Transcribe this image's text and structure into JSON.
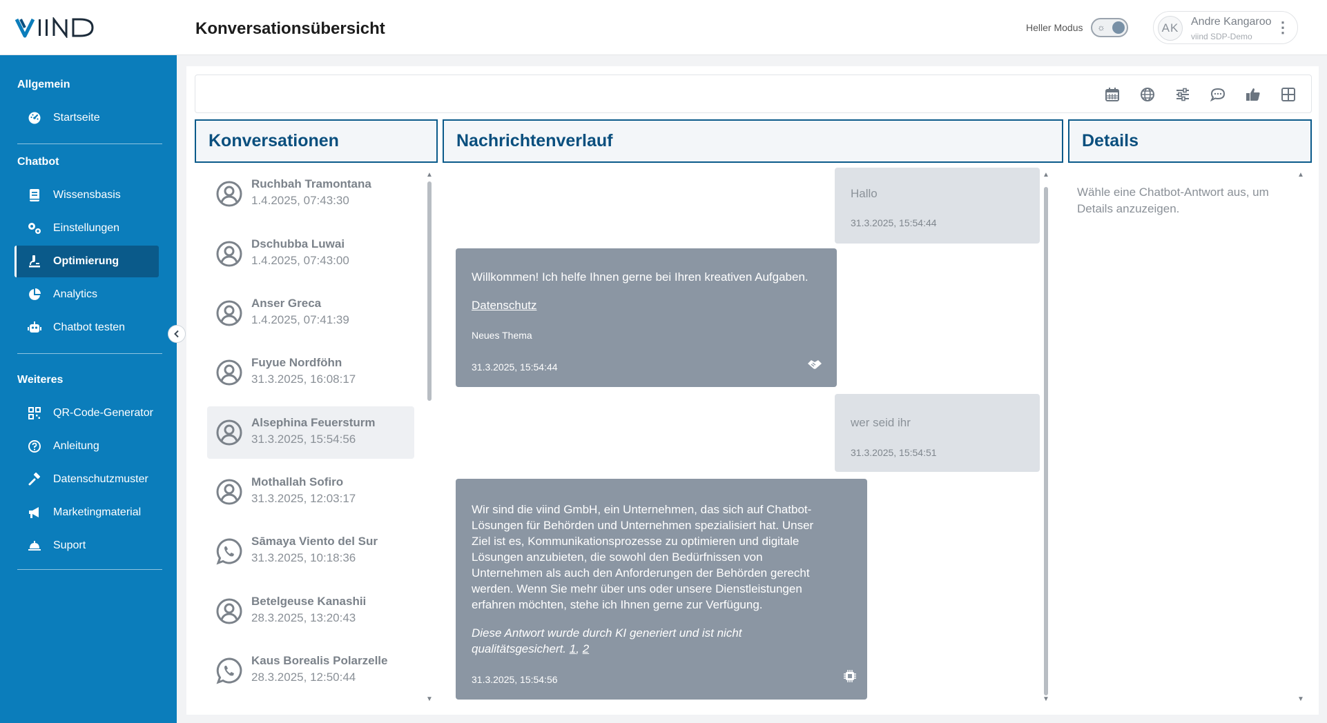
{
  "app": {
    "title": "Konversationsübersicht",
    "mode_label": "Heller Modus",
    "user": {
      "initials": "AK",
      "name": "Andre Kangaroo",
      "org": "viind SDP-Demo"
    }
  },
  "sidebar": {
    "sections": [
      {
        "label": "Allgemein",
        "items": [
          {
            "label": "Startseite",
            "icon": "dashboard-icon"
          }
        ]
      },
      {
        "label": "Chatbot",
        "items": [
          {
            "label": "Wissensbasis",
            "icon": "book-icon"
          },
          {
            "label": "Einstellungen",
            "icon": "gears-icon"
          },
          {
            "label": "Optimierung",
            "icon": "microscope-icon",
            "active": true
          },
          {
            "label": "Analytics",
            "icon": "pie-chart-icon"
          },
          {
            "label": "Chatbot testen",
            "icon": "robot-icon"
          }
        ]
      },
      {
        "label": "Weiteres",
        "items": [
          {
            "label": "QR-Code-Generator",
            "icon": "qr-code-icon"
          },
          {
            "label": "Anleitung",
            "icon": "help-circle-icon"
          },
          {
            "label": "Datenschutzmuster",
            "icon": "gavel-icon"
          },
          {
            "label": "Marketingmaterial",
            "icon": "megaphone-icon"
          },
          {
            "label": "Suport",
            "icon": "bell-service-icon"
          }
        ]
      }
    ]
  },
  "toolbar": {
    "icons": [
      "calendar-icon",
      "globe-icon",
      "sliders-icon",
      "comment-icon",
      "thumbs-up-icon",
      "grid-icon"
    ]
  },
  "panels": {
    "conversations_title": "Konversationen",
    "history_title": "Nachrichtenverlauf",
    "details_title": "Details"
  },
  "conversations": [
    {
      "name": "Ruchbah Tramontana",
      "time": "1.4.2025, 07:43:30",
      "channel": "web"
    },
    {
      "name": "Dschubba Luwai",
      "time": "1.4.2025, 07:43:00",
      "channel": "web"
    },
    {
      "name": "Anser Greca",
      "time": "1.4.2025, 07:41:39",
      "channel": "web"
    },
    {
      "name": "Fuyue Nordföhn",
      "time": "31.3.2025, 16:08:17",
      "channel": "web"
    },
    {
      "name": "Alsephina Feuersturm",
      "time": "31.3.2025, 15:54:56",
      "channel": "web",
      "selected": true
    },
    {
      "name": "Mothallah Sofiro",
      "time": "31.3.2025, 12:03:17",
      "channel": "web"
    },
    {
      "name": "Sāmaya Viento del Sur",
      "time": "31.3.2025, 10:18:36",
      "channel": "whatsapp"
    },
    {
      "name": "Betelgeuse Kanashii",
      "time": "28.3.2025, 13:20:43",
      "channel": "web"
    },
    {
      "name": "Kaus Borealis Polarzelle",
      "time": "28.3.2025, 12:50:44",
      "channel": "whatsapp"
    }
  ],
  "messages": {
    "m1": {
      "text": "Hallo",
      "time": "31.3.2025, 15:54:44"
    },
    "m2": {
      "text": "Willkommen! Ich helfe Ihnen gerne bei Ihren kreativen Aufgaben.",
      "link": "Datenschutz",
      "tag": "Neues Thema",
      "time": "31.3.2025, 15:54:44"
    },
    "m3": {
      "text": "wer seid ihr",
      "time": "31.3.2025, 15:54:51"
    },
    "m4": {
      "lines": [
        "Wir sind die viind GmbH, ein Unternehmen, das sich auf Chatbot-",
        "Lösungen für Behörden und Unternehmen spezialisiert hat. Unser",
        "Ziel ist es, Kommunikationsprozesse zu optimieren und digitale",
        "Lösungen anzubieten, die sowohl den Bedürfnissen von",
        "Unternehmen als auch den Anforderungen der Behörden gerecht",
        "werden. Wenn Sie mehr über uns oder unsere Dienstleistungen",
        "erfahren möchten, stehe ich Ihnen gerne zur Verfügung."
      ],
      "disclaimer_1": "Diese Antwort wurde durch KI generiert und ist nicht",
      "disclaimer_2": "qualitätsgesichert.",
      "source_1": "1",
      "source_sep": ",",
      "source_2": "2",
      "time": "31.3.2025, 15:54:56"
    }
  },
  "details": {
    "placeholder": "Wähle eine Chatbot-Antwort aus, um Details anzuzeigen."
  },
  "colors": {
    "sidebar": "#0b7dbb",
    "sidebar_active": "#0a5a8a",
    "bot_bubble": "#8b96a3",
    "user_bubble": "#dde1e6"
  }
}
